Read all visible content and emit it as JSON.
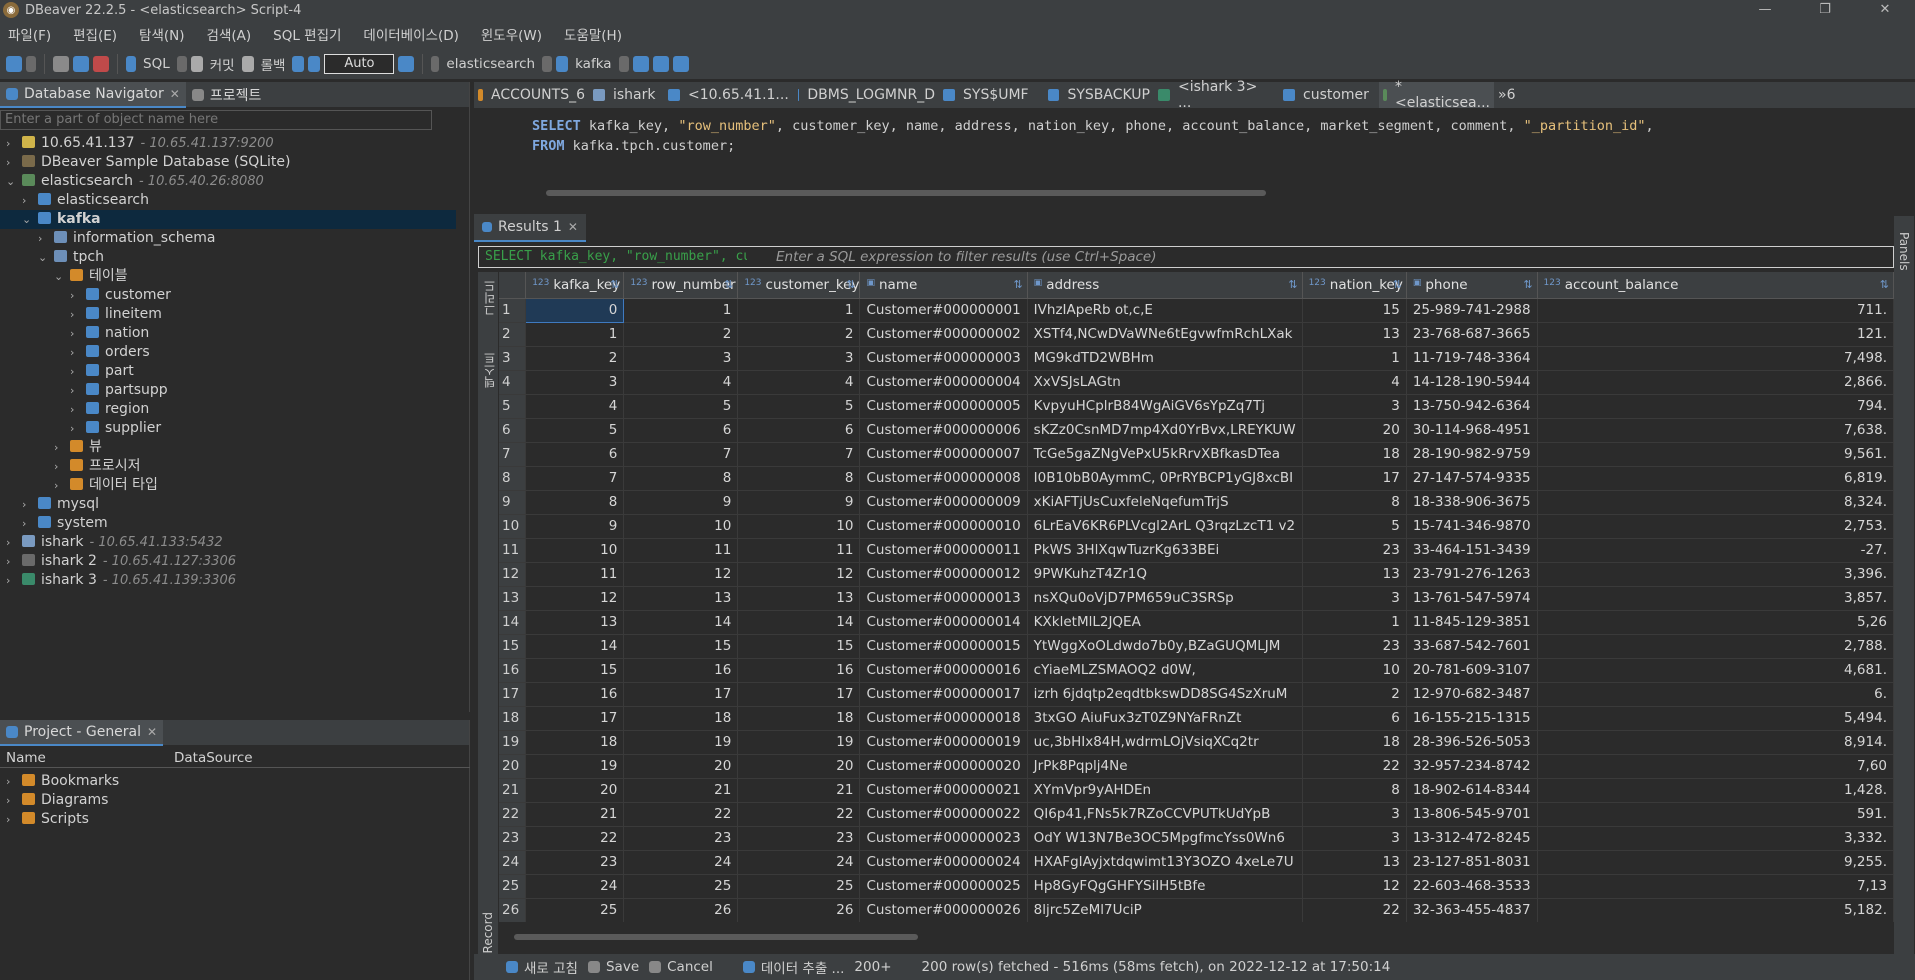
{
  "window": {
    "title": "DBeaver 22.2.5 - <elasticsearch> Script-4",
    "controls": [
      "—",
      "❐",
      "✕"
    ]
  },
  "menu": [
    "파일(F)",
    "편집(E)",
    "탐색(N)",
    "검색(A)",
    "SQL 편집기",
    "데이터베이스(D)",
    "윈도우(W)",
    "도움말(H)"
  ],
  "toolbar": {
    "sql": "SQL",
    "commit": "커밋",
    "rollback": "롤백",
    "auto": "Auto",
    "datasource": "elasticsearch",
    "schema": "kafka"
  },
  "navigator": {
    "tab_label": "Database Navigator",
    "tab2_label": "프로젝트",
    "filter_placeholder": "Enter a part of object name here",
    "tree": [
      {
        "label": "10.65.41.137",
        "sub": "- 10.65.41.137:9200",
        "depth": 0,
        "arrow": "›",
        "color": "#d0b44a"
      },
      {
        "label": "DBeaver Sample Database (SQLite)",
        "sub": "",
        "depth": 0,
        "arrow": "›",
        "color": "#7a6a4a"
      },
      {
        "label": "elasticsearch",
        "sub": "- 10.65.40.26:8080",
        "depth": 0,
        "arrow": "⌄",
        "color": "#5a8a5a"
      },
      {
        "label": "elasticsearch",
        "sub": "",
        "depth": 1,
        "arrow": "›",
        "color": "#4a88c7"
      },
      {
        "label": "kafka",
        "sub": "",
        "depth": 1,
        "arrow": "⌄",
        "color": "#4a88c7",
        "selected": true
      },
      {
        "label": "information_schema",
        "sub": "",
        "depth": 2,
        "arrow": "›",
        "color": "#6d8fb8"
      },
      {
        "label": "tpch",
        "sub": "",
        "depth": 2,
        "arrow": "⌄",
        "color": "#6d8fb8"
      },
      {
        "label": "테이블",
        "sub": "",
        "depth": 3,
        "arrow": "⌄",
        "color": "#d38a2a"
      },
      {
        "label": "customer",
        "sub": "",
        "depth": 4,
        "arrow": "›",
        "color": "#4a88c7"
      },
      {
        "label": "lineitem",
        "sub": "",
        "depth": 4,
        "arrow": "›",
        "color": "#4a88c7"
      },
      {
        "label": "nation",
        "sub": "",
        "depth": 4,
        "arrow": "›",
        "color": "#4a88c7"
      },
      {
        "label": "orders",
        "sub": "",
        "depth": 4,
        "arrow": "›",
        "color": "#4a88c7"
      },
      {
        "label": "part",
        "sub": "",
        "depth": 4,
        "arrow": "›",
        "color": "#4a88c7"
      },
      {
        "label": "partsupp",
        "sub": "",
        "depth": 4,
        "arrow": "›",
        "color": "#4a88c7"
      },
      {
        "label": "region",
        "sub": "",
        "depth": 4,
        "arrow": "›",
        "color": "#4a88c7"
      },
      {
        "label": "supplier",
        "sub": "",
        "depth": 4,
        "arrow": "›",
        "color": "#4a88c7"
      },
      {
        "label": "뷰",
        "sub": "",
        "depth": 3,
        "arrow": "›",
        "color": "#d38a2a"
      },
      {
        "label": "프로시저",
        "sub": "",
        "depth": 3,
        "arrow": "›",
        "color": "#d38a2a"
      },
      {
        "label": "데이터 타입",
        "sub": "",
        "depth": 3,
        "arrow": "›",
        "color": "#d38a2a"
      },
      {
        "label": "mysql",
        "sub": "",
        "depth": 1,
        "arrow": "›",
        "color": "#4a88c7"
      },
      {
        "label": "system",
        "sub": "",
        "depth": 1,
        "arrow": "›",
        "color": "#4a88c7"
      },
      {
        "label": "ishark",
        "sub": "- 10.65.41.133:5432",
        "depth": 0,
        "arrow": "›",
        "color": "#7a9ac0"
      },
      {
        "label": "ishark 2",
        "sub": "- 10.65.41.127:3306",
        "depth": 0,
        "arrow": "›",
        "color": "#6a6a6a"
      },
      {
        "label": "ishark 3",
        "sub": "- 10.65.41.139:3306",
        "depth": 0,
        "arrow": "›",
        "color": "#3a8a6a"
      }
    ]
  },
  "project": {
    "tab_label": "Project - General",
    "col_name": "Name",
    "col_datasource": "DataSource",
    "items": [
      "Bookmarks",
      "Diagrams",
      "Scripts"
    ]
  },
  "editor": {
    "tabs": [
      "ACCOUNTS_6",
      "ishark",
      "<10.65.41.1...",
      "DBMS_LOGMNR_D",
      "SYS$UMF",
      "SYSBACKUP",
      "<ishark 3> ...",
      "customer",
      "*<elasticsea...",
      "»6"
    ],
    "line1_kw": "SELECT",
    "line1_rest": " kafka_key, ",
    "line1_str": "\"row_number\"",
    "line1_rest2": ", customer_key, name, address, nation_key, phone, account_balance, market_segment, comment, ",
    "line1_str2": "\"_partition_id\"",
    "line1_end": ",",
    "line2_kw": "FROM",
    "line2_rest": " kafka.tpch.customer;"
  },
  "results": {
    "tab_label": "Results 1",
    "filter_sql": "SELECT kafka_key, \"row_number\", customer_k",
    "filter_placeholder": "Enter a SQL expression to filter results (use Ctrl+Space)",
    "columns": [
      "kafka_key",
      "row_number",
      "customer_key",
      "name",
      "address",
      "nation_key",
      "phone",
      "account_balance"
    ],
    "rows": [
      [
        "1",
        "0",
        "1",
        "1",
        "Customer#000000001",
        "IVhzIApeRb ot,c,E",
        "15",
        "25-989-741-2988",
        "711."
      ],
      [
        "2",
        "1",
        "2",
        "2",
        "Customer#000000002",
        "XSTf4,NCwDVaWNe6tEgvwfmRchLXak",
        "13",
        "23-768-687-3665",
        "121."
      ],
      [
        "3",
        "2",
        "3",
        "3",
        "Customer#000000003",
        "MG9kdTD2WBHm",
        "1",
        "11-719-748-3364",
        "7,498."
      ],
      [
        "4",
        "3",
        "4",
        "4",
        "Customer#000000004",
        "XxVSJsLAGtn",
        "4",
        "14-128-190-5944",
        "2,866."
      ],
      [
        "5",
        "4",
        "5",
        "5",
        "Customer#000000005",
        "KvpyuHCplrB84WgAiGV6sYpZq7Tj",
        "3",
        "13-750-942-6364",
        "794."
      ],
      [
        "6",
        "5",
        "6",
        "6",
        "Customer#000000006",
        "sKZz0CsnMD7mp4Xd0YrBvx,LREYKUW",
        "20",
        "30-114-968-4951",
        "7,638."
      ],
      [
        "7",
        "6",
        "7",
        "7",
        "Customer#000000007",
        "TcGe5gaZNgVePxU5kRrvXBfkasDTea",
        "18",
        "28-190-982-9759",
        "9,561."
      ],
      [
        "8",
        "7",
        "8",
        "8",
        "Customer#000000008",
        "I0B10bB0AymmC, 0PrRYBCP1yGJ8xcBI",
        "17",
        "27-147-574-9335",
        "6,819."
      ],
      [
        "9",
        "8",
        "9",
        "9",
        "Customer#000000009",
        "xKiAFTjUsCuxfeleNqefumTrjS",
        "8",
        "18-338-906-3675",
        "8,324."
      ],
      [
        "10",
        "9",
        "10",
        "10",
        "Customer#000000010",
        "6LrEaV6KR6PLVcgl2ArL Q3rqzLzcT1 v2",
        "5",
        "15-741-346-9870",
        "2,753."
      ],
      [
        "11",
        "10",
        "11",
        "11",
        "Customer#000000011",
        "PkWS 3HlXqwTuzrKg633BEi",
        "23",
        "33-464-151-3439",
        "-27."
      ],
      [
        "12",
        "11",
        "12",
        "12",
        "Customer#000000012",
        "9PWKuhzT4Zr1Q",
        "13",
        "23-791-276-1263",
        "3,396."
      ],
      [
        "13",
        "12",
        "13",
        "13",
        "Customer#000000013",
        "nsXQu0oVjD7PM659uC3SRSp",
        "3",
        "13-761-547-5974",
        "3,857."
      ],
      [
        "14",
        "13",
        "14",
        "14",
        "Customer#000000014",
        "KXkletMlL2JQEA",
        "1",
        "11-845-129-3851",
        "5,26"
      ],
      [
        "15",
        "14",
        "15",
        "15",
        "Customer#000000015",
        "YtWggXoOLdwdo7b0y,BZaGUQMLJM",
        "23",
        "33-687-542-7601",
        "2,788."
      ],
      [
        "16",
        "15",
        "16",
        "16",
        "Customer#000000016",
        "cYiaeMLZSMAOQ2 d0W,",
        "10",
        "20-781-609-3107",
        "4,681."
      ],
      [
        "17",
        "16",
        "17",
        "17",
        "Customer#000000017",
        "izrh 6jdqtp2eqdtbkswDD8SG4SzXruM",
        "2",
        "12-970-682-3487",
        "6."
      ],
      [
        "18",
        "17",
        "18",
        "18",
        "Customer#000000018",
        "3txGO AiuFux3zT0Z9NYaFRnZt",
        "6",
        "16-155-215-1315",
        "5,494."
      ],
      [
        "19",
        "18",
        "19",
        "19",
        "Customer#000000019",
        "uc,3bHIx84H,wdrmLOjVsiqXCq2tr",
        "18",
        "28-396-526-5053",
        "8,914."
      ],
      [
        "20",
        "19",
        "20",
        "20",
        "Customer#000000020",
        "JrPk8Pqplj4Ne",
        "22",
        "32-957-234-8742",
        "7,60"
      ],
      [
        "21",
        "20",
        "21",
        "21",
        "Customer#000000021",
        "XYmVpr9yAHDEn",
        "8",
        "18-902-614-8344",
        "1,428."
      ],
      [
        "22",
        "21",
        "22",
        "22",
        "Customer#000000022",
        "QI6p41,FNs5k7RZoCCVPUTkUdYpB",
        "3",
        "13-806-545-9701",
        "591."
      ],
      [
        "23",
        "22",
        "23",
        "23",
        "Customer#000000023",
        "OdY W13N7Be3OC5MpgfmcYss0Wn6",
        "3",
        "13-312-472-8245",
        "3,332."
      ],
      [
        "24",
        "23",
        "24",
        "24",
        "Customer#000000024",
        "HXAFgIAyjxtdqwimt13Y3OZO 4xeLe7U",
        "13",
        "23-127-851-8031",
        "9,255."
      ],
      [
        "25",
        "24",
        "25",
        "25",
        "Customer#000000025",
        "Hp8GyFQgGHFYSilH5tBfe",
        "12",
        "22-603-468-3533",
        "7,13"
      ],
      [
        "26",
        "25",
        "26",
        "26",
        "Customer#000000026",
        "8ljrc5ZeMl7UciP",
        "22",
        "32-363-455-4837",
        "5,182."
      ]
    ],
    "side_grid": "그리드",
    "side_text": "텍스트",
    "side_record": "Record",
    "side_panels": "Panels"
  },
  "status": {
    "refresh": "새로 고침",
    "save": "Save",
    "cancel": "Cancel",
    "export": "데이터 추출 ...",
    "count": "200+",
    "message": "200 row(s) fetched - 516ms (58ms fetch), on 2022-12-12 at 17:50:14"
  }
}
